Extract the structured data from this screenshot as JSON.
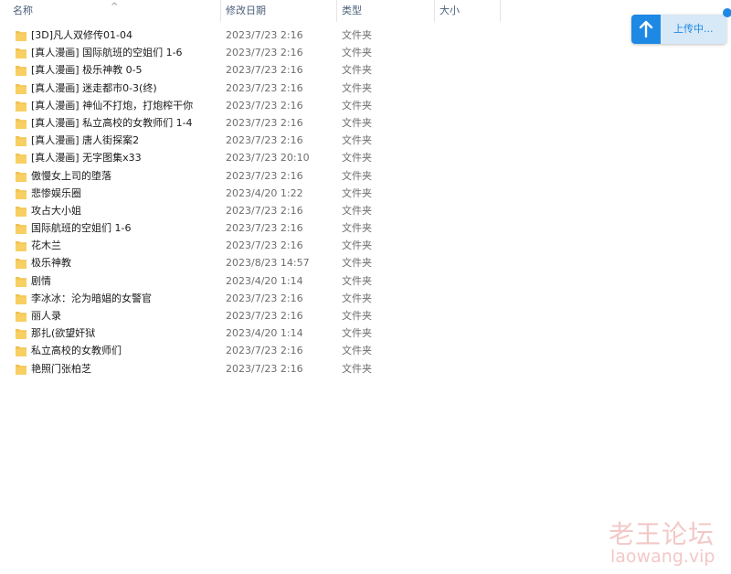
{
  "header": {
    "name_label": "名称",
    "date_label": "修改日期",
    "type_label": "类型",
    "size_label": "大小",
    "sort_indicator": "^"
  },
  "files": [
    {
      "name": "[3D]凡人双修传01-04",
      "date": "2023/7/23 2:16",
      "type": "文件夹"
    },
    {
      "name": "[真人漫画] 国际航班的空姐们 1-6",
      "date": "2023/7/23 2:16",
      "type": "文件夹"
    },
    {
      "name": "[真人漫画] 极乐神教 0-5",
      "date": "2023/7/23 2:16",
      "type": "文件夹"
    },
    {
      "name": "[真人漫画] 迷走都市0-3(终)",
      "date": "2023/7/23 2:16",
      "type": "文件夹"
    },
    {
      "name": "[真人漫画] 神仙不打炮，打炮榨干你",
      "date": "2023/7/23 2:16",
      "type": "文件夹"
    },
    {
      "name": "[真人漫画] 私立高校的女教师们 1-4",
      "date": "2023/7/23 2:16",
      "type": "文件夹"
    },
    {
      "name": "[真人漫画] 唐人街探案2",
      "date": "2023/7/23 2:16",
      "type": "文件夹"
    },
    {
      "name": "[真人漫画] 无字图集x33",
      "date": "2023/7/23 20:10",
      "type": "文件夹"
    },
    {
      "name": "傲慢女上司的堕落",
      "date": "2023/7/23 2:16",
      "type": "文件夹"
    },
    {
      "name": "悲惨娱乐圈",
      "date": "2023/4/20 1:22",
      "type": "文件夹"
    },
    {
      "name": "攻占大小姐",
      "date": "2023/7/23 2:16",
      "type": "文件夹"
    },
    {
      "name": "国际航班的空姐们 1-6",
      "date": "2023/7/23 2:16",
      "type": "文件夹"
    },
    {
      "name": "花木兰",
      "date": "2023/7/23 2:16",
      "type": "文件夹"
    },
    {
      "name": "极乐神教",
      "date": "2023/8/23 14:57",
      "type": "文件夹"
    },
    {
      "name": "剧情",
      "date": "2023/4/20 1:14",
      "type": "文件夹"
    },
    {
      "name": "李冰冰：沦为暗娼的女警官",
      "date": "2023/7/23 2:16",
      "type": "文件夹"
    },
    {
      "name": "丽人录",
      "date": "2023/7/23 2:16",
      "type": "文件夹"
    },
    {
      "name": "那扎(欲望奸狱",
      "date": "2023/4/20 1:14",
      "type": "文件夹"
    },
    {
      "name": "私立高校的女教师们",
      "date": "2023/7/23 2:16",
      "type": "文件夹"
    },
    {
      "name": "艳照门张柏芝",
      "date": "2023/7/23 2:16",
      "type": "文件夹"
    }
  ],
  "upload": {
    "label": "上传中...",
    "accent_color": "#1e88e5",
    "icon": "upload-arrow-icon"
  },
  "watermark": {
    "text_cn": "老王论坛",
    "text_en": "laowang.vip"
  },
  "colors": {
    "folder": "#f2c14e",
    "header_text": "#4c607a"
  }
}
